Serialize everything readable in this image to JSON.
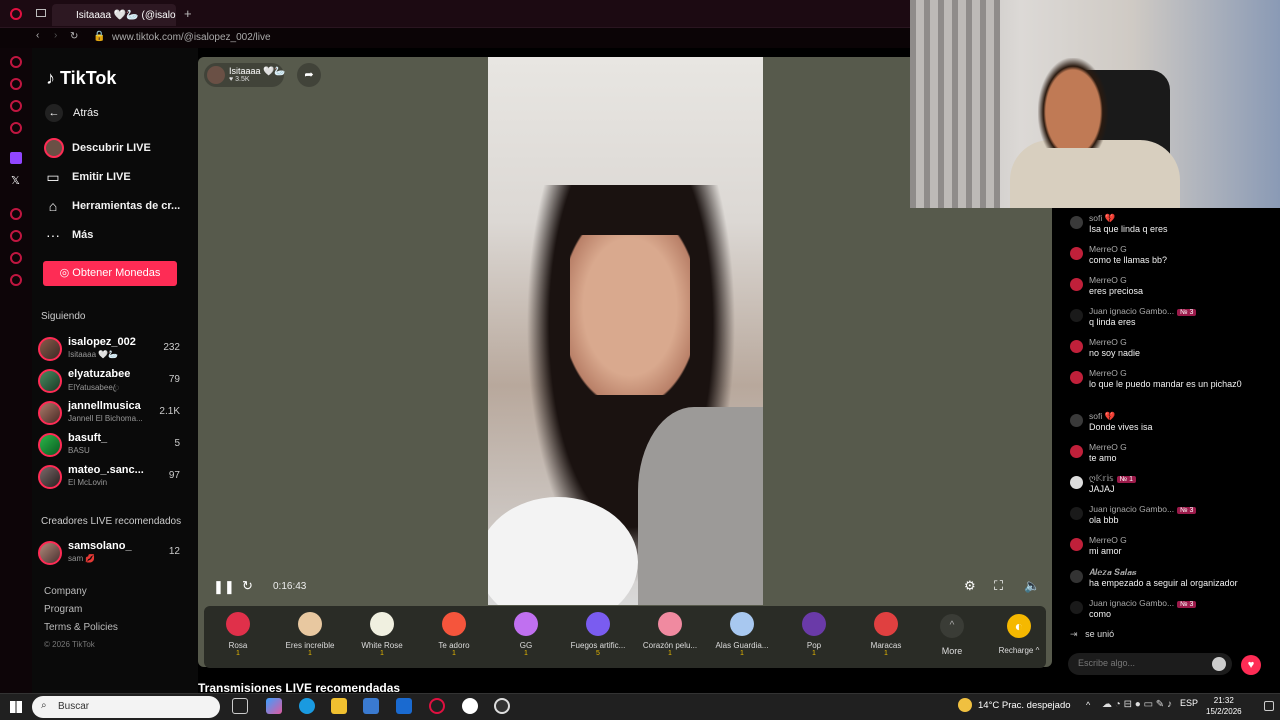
{
  "browser": {
    "tab_title": "Isitaaaa 🤍🦢 (@isalop",
    "url": "www.tiktok.com/@isalopez_002/live"
  },
  "sidebar": {
    "logo": "TikTok",
    "back": "Atrás",
    "nav": [
      {
        "label": "Descubrir LIVE",
        "icon": "live-avatar-icon"
      },
      {
        "label": "Emitir LIVE",
        "icon": "video-camera-icon"
      },
      {
        "label": "Herramientas de cr...",
        "icon": "tools-icon"
      },
      {
        "label": "Más",
        "icon": "more-dots-icon"
      }
    ],
    "coins_button": "Obtener Monedas",
    "following_title": "Siguiendo",
    "following": [
      {
        "name": "isalopez_002",
        "sub": "Isitaaaa 🤍🦢",
        "count": "232"
      },
      {
        "name": "elyatuzabee",
        "sub": "ElYatusabeeꦿ",
        "count": "79"
      },
      {
        "name": "jannellmusica",
        "sub": "Jannell El Bichoma...",
        "count": "2.1K"
      },
      {
        "name": "basuft_",
        "sub": "BASU",
        "count": "5"
      },
      {
        "name": "mateo_.sanc...",
        "sub": "El McLovin",
        "count": "97"
      }
    ],
    "recommended_title": "Creadores LIVE recomendados",
    "recommended": [
      {
        "name": "samsolano_",
        "sub": "sam 💋",
        "count": "12"
      }
    ],
    "footer": [
      "Company",
      "Program",
      "Terms & Policies",
      "© 2026 TikTok"
    ]
  },
  "stream": {
    "host_name": "Isitaaaa 🤍🦢",
    "host_likes": "♥ 3.5K",
    "elapsed": "0:16:43"
  },
  "gifts": [
    {
      "name": "Rosa",
      "coins": "1",
      "icon": "rose-icon",
      "color": "#e0304a"
    },
    {
      "name": "Eres increíble",
      "coins": "1",
      "icon": "cat-icon",
      "color": "#e8c8a0"
    },
    {
      "name": "White Rose",
      "coins": "1",
      "icon": "white-rose-icon",
      "color": "#f0f0e0"
    },
    {
      "name": "Te adoro",
      "coins": "1",
      "icon": "heart-love-icon",
      "color": "#f5553c"
    },
    {
      "name": "GG",
      "coins": "1",
      "icon": "gg-icon",
      "color": "#c070f0"
    },
    {
      "name": "Fuegos artific...",
      "coins": "5",
      "icon": "fireworks-icon",
      "color": "#7a5cf0"
    },
    {
      "name": "Corazón pelu...",
      "coins": "1",
      "icon": "fluffy-heart-icon",
      "color": "#f08aa0"
    },
    {
      "name": "Alas Guardia...",
      "coins": "1",
      "icon": "wings-icon",
      "color": "#a8c8f0"
    },
    {
      "name": "Pop",
      "coins": "1",
      "icon": "pop-icon",
      "color": "#6a3aa8"
    },
    {
      "name": "Maracas",
      "coins": "1",
      "icon": "maracas-icon",
      "color": "#e04040"
    }
  ],
  "more_label": "More",
  "recharge_label": "Recharge ^",
  "recommended_streams_title": "Transmisiones LIVE recomendadas",
  "chat": [
    {
      "user": "sofi 💔",
      "text": "Isa que linda q eres",
      "badge": ""
    },
    {
      "user": "MerreO G",
      "text": "como te llamas bb?",
      "badge": ""
    },
    {
      "user": "MerreO G",
      "text": "eres preciosa",
      "badge": ""
    },
    {
      "user": "Juan ignacio Gambo...",
      "text": "q linda eres",
      "badge": "№ 3"
    },
    {
      "user": "MerreO G",
      "text": "no soy nadie",
      "badge": ""
    },
    {
      "user": "MerreO G",
      "text": "lo que le puedo mandar es un pichaz0",
      "badge": ""
    },
    {
      "user": "sofi 💔",
      "text": "Donde vives isa",
      "badge": ""
    },
    {
      "user": "MerreO G",
      "text": "te amo",
      "badge": ""
    },
    {
      "user": "ღ𝕂𝕣𝕚𝕤",
      "text": "JAJAJ",
      "badge": "№ 1"
    },
    {
      "user": "Juan ignacio Gambo...",
      "text": "ola bbb",
      "badge": "№ 3"
    },
    {
      "user": "MerreO G",
      "text": "mi amor",
      "badge": ""
    },
    {
      "user": "𝑨𝒍𝒆𝒛𝒂 𝑺𝒂𝒍𝒂𝒔",
      "text": "ha empezado a seguir al organizador",
      "badge": ""
    },
    {
      "user": "Juan ignacio Gambo...",
      "text": "como",
      "badge": "№ 3"
    }
  ],
  "join_text": "se unió",
  "chat_placeholder": "Escribe algo...",
  "taskbar": {
    "search": "Buscar",
    "weather": "14°C  Prac. despejado",
    "lang": "ESP",
    "time": "21:32",
    "date": "15/2/2026"
  }
}
